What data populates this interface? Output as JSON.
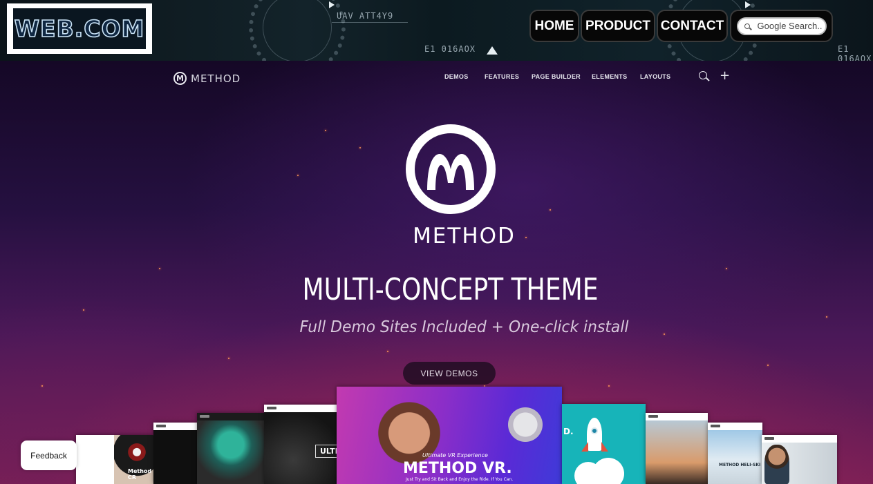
{
  "site": {
    "logo_text": "WEB.COM",
    "nav": [
      {
        "label": "HOME"
      },
      {
        "label": "PRODUCT"
      },
      {
        "label": "CONTACT"
      }
    ],
    "search": {
      "placeholder": "Google Search.."
    },
    "banner_readouts": {
      "left_code": "UAV ATT4Y9",
      "left_bottom": "E1 016AOX",
      "right_bottom": "E1 016AOX"
    }
  },
  "theme": {
    "logo_word": "METHOD",
    "nav": [
      {
        "label": "DEMOS"
      },
      {
        "label": "FEATURES"
      },
      {
        "label": "PAGE BUILDER"
      },
      {
        "label": "ELEMENTS"
      },
      {
        "label": "LAYOUTS"
      }
    ],
    "hero": {
      "brand": "METHOD",
      "headline": "MULTI-CONCEPT THEME",
      "subline": "Full Demo Sites Included + One-click install",
      "cta": "VIEW DEMOS"
    },
    "previews": {
      "vr_tagline": "Ultimate VR Experience",
      "vr_title": "METHOD VR.",
      "vr_sub": "Just Try and Sit Back and Enjoy the Ride. If You Can.",
      "creative_caption": "Method CR",
      "ulti_caption": "ULTI",
      "heli_caption": "METHOD HELI-SKI",
      "rocket_caption": "D."
    }
  },
  "widgets": {
    "feedback_label": "Feedback"
  },
  "colors": {
    "hero_top": "#150826",
    "hero_bottom": "#7a1f55",
    "nav_button_bg": "#070707"
  }
}
